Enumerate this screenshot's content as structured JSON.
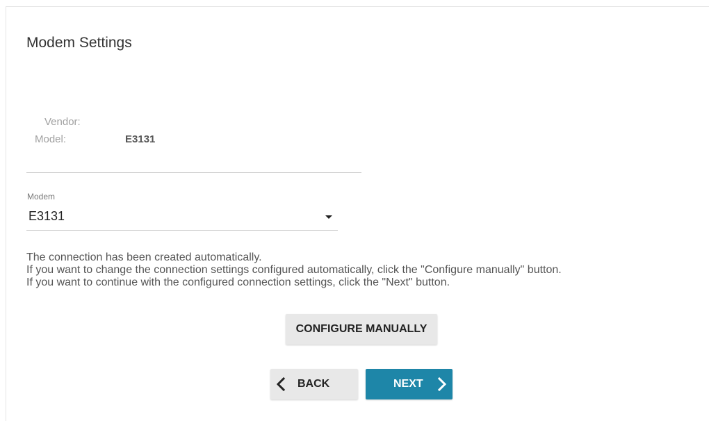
{
  "page": {
    "title": "Modem Settings"
  },
  "info": {
    "vendor_label": "Vendor:",
    "vendor_value": "",
    "model_label": "Model:",
    "model_value": "E3131"
  },
  "modem_select": {
    "label": "Modem",
    "value": "E3131"
  },
  "message": {
    "line1": "The connection has been created automatically.",
    "line2": "If you want to change the connection settings configured automatically, click the \"Configure manually\" button.",
    "line3": "If you want to continue with the configured connection settings, click the \"Next\" button."
  },
  "buttons": {
    "configure_manually": "CONFIGURE MANUALLY",
    "back": "BACK",
    "next": "NEXT"
  },
  "icons": {
    "back": "chevron-left-icon",
    "next": "chevron-right-icon",
    "select": "caret-down-icon"
  },
  "colors": {
    "primary": "#1e86a8",
    "secondary_button": "#e8e8e8"
  }
}
